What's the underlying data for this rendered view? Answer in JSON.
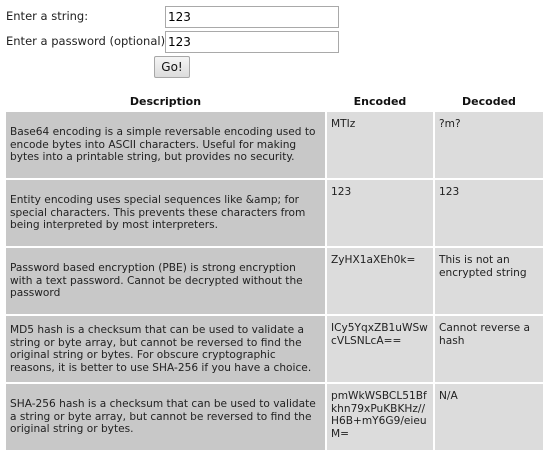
{
  "form": {
    "string_label": "Enter a string:",
    "string_value": "123",
    "password_label": "Enter a password (optional):",
    "password_value": "123",
    "go_label": "Go!"
  },
  "table": {
    "headers": [
      "Description",
      "Encoded",
      "Decoded"
    ],
    "rows": [
      {
        "description": "Base64 encoding is a simple reversable encoding used to encode bytes into ASCII characters. Useful for making bytes into a printable string, but provides no security.",
        "encoded": "MTIz",
        "decoded": "?m?"
      },
      {
        "description": "Entity encoding uses special sequences like &amp; for special characters. This prevents these characters from being interpreted by most interpreters.",
        "encoded": "123",
        "decoded": "123"
      },
      {
        "description": "Password based encryption (PBE) is strong encryption with a text password. Cannot be decrypted without the password",
        "encoded": "ZyHX1aXEh0k=",
        "decoded": "This is not an encrypted string"
      },
      {
        "description": "MD5 hash is a checksum that can be used to validate a string or byte array, but cannot be reversed to find the original string or bytes. For obscure cryptographic reasons, it is better to use SHA-256 if you have a choice.",
        "encoded": "ICy5YqxZB1uWSwcVLSNLcA==",
        "decoded": "Cannot reverse a hash"
      },
      {
        "description": "SHA-256 hash is a checksum that can be used to validate a string or byte array, but cannot be reversed to find the original string or bytes.",
        "encoded": "pmWkWSBCL51Bfkhn79xPuKBKHz//H6B+mY6G9/eieuM=",
        "decoded": "N/A"
      }
    ]
  }
}
